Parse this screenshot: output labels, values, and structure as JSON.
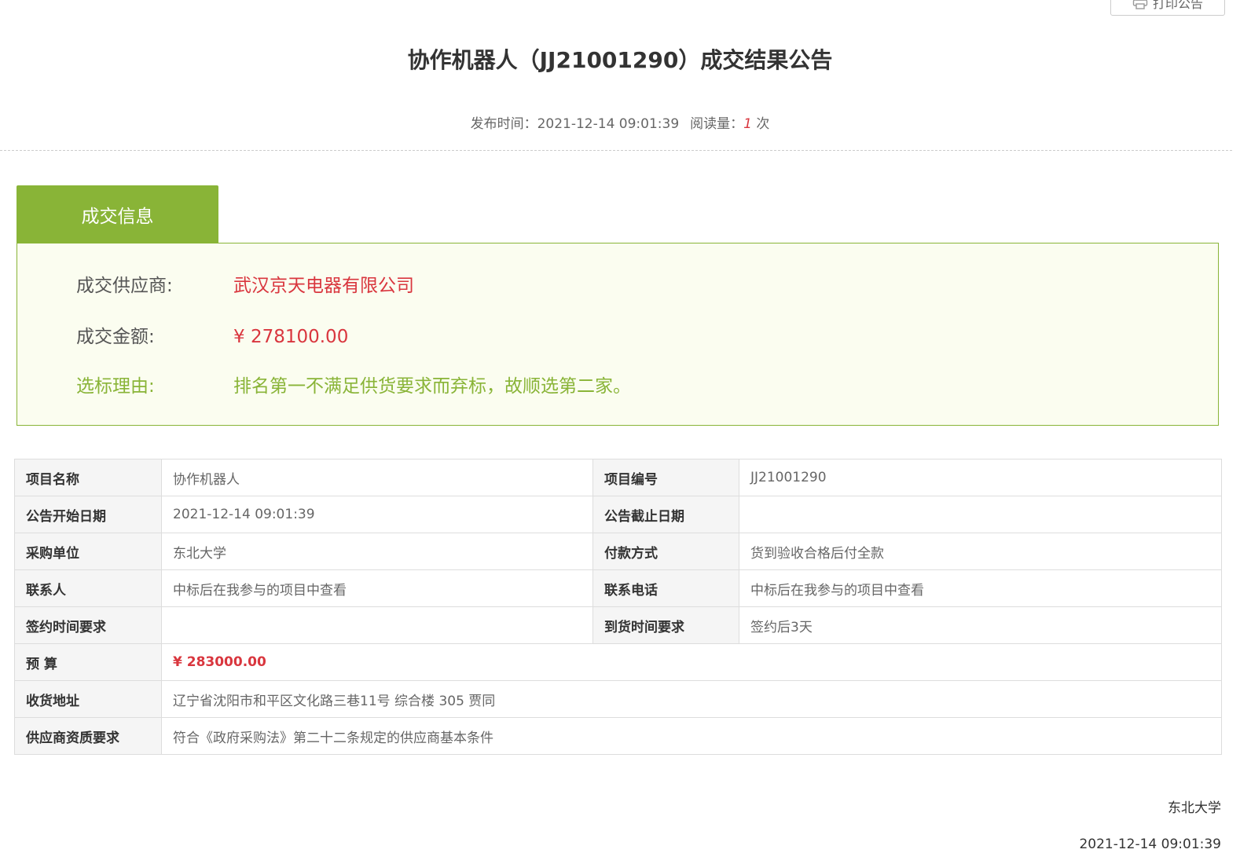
{
  "toolbar": {
    "print_label": "打印公告"
  },
  "header": {
    "title": "协作机器人（JJ21001290）成交结果公告",
    "publish_label": "发布时间：",
    "publish_time": "2021-12-14 09:01:39",
    "read_label": "阅读量：",
    "read_count": "1",
    "read_unit": "次"
  },
  "deal": {
    "tab_label": "成交信息",
    "supplier_label": "成交供应商:",
    "supplier_value": "武汉京天电器有限公司",
    "amount_label": "成交金额:",
    "amount_value": "¥ 278100.00",
    "reason_label": "选标理由:",
    "reason_value": "排名第一不满足供货要求而弃标，故顺选第二家。"
  },
  "details": {
    "project_name_label": "项目名称",
    "project_name": "协作机器人",
    "project_no_label": "项目编号",
    "project_no": "JJ21001290",
    "start_date_label": "公告开始日期",
    "start_date": "2021-12-14 09:01:39",
    "end_date_label": "公告截止日期",
    "end_date": "",
    "buyer_label": "采购单位",
    "buyer": "东北大学",
    "payment_label": "付款方式",
    "payment": "货到验收合格后付全款",
    "contact_label": "联系人",
    "contact": "中标后在我参与的项目中查看",
    "phone_label": "联系电话",
    "phone": "中标后在我参与的项目中查看",
    "sign_time_label": "签约时间要求",
    "sign_time": "",
    "delivery_time_label": "到货时间要求",
    "delivery_time": "签约后3天",
    "budget_label": "预 算",
    "budget": "¥ 283000.00",
    "address_label": "收货地址",
    "address": "辽宁省沈阳市和平区文化路三巷11号 综合楼 305 贾同",
    "qualification_label": "供应商资质要求",
    "qualification": "符合《政府采购法》第二十二条规定的供应商基本条件"
  },
  "footer": {
    "org": "东北大学",
    "date": "2021-12-14 09:01:39"
  },
  "colors": {
    "accent_green": "#89b437",
    "highlight_red": "#d9363e"
  }
}
